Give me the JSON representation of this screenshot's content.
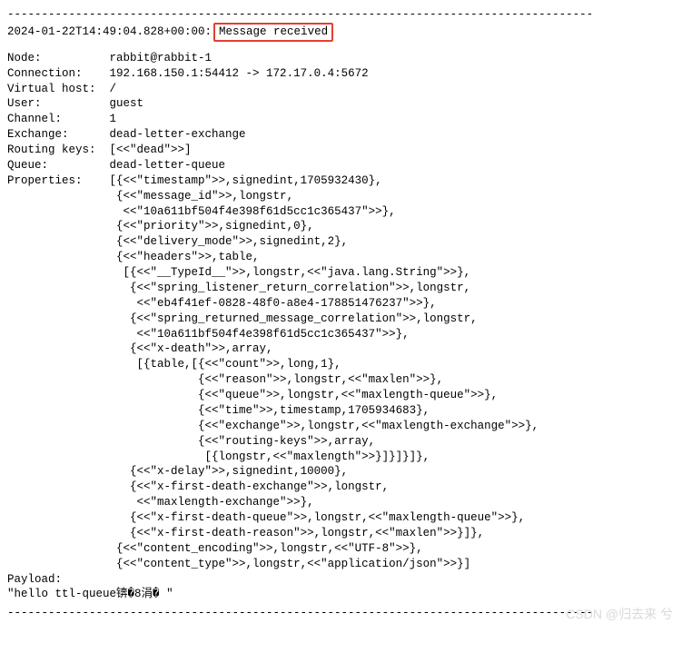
{
  "separator": "--------------------------------------------------------------------------------------",
  "header": {
    "timestamp": "2024-01-22T14:49:04.828+00:00:",
    "status": " Message received "
  },
  "fields": {
    "node": {
      "key": "Node:          ",
      "val": "rabbit@rabbit-1"
    },
    "connection": {
      "key": "Connection:    ",
      "val": "192.168.150.1:54412 -> 172.17.0.4:5672"
    },
    "vhost": {
      "key": "Virtual host:  ",
      "val": "/"
    },
    "user": {
      "key": "User:          ",
      "val": "guest"
    },
    "channel": {
      "key": "Channel:       ",
      "val": "1"
    },
    "exchange": {
      "key": "Exchange:      ",
      "val": "dead-letter-exchange"
    },
    "routing": {
      "key": "Routing keys:  ",
      "val": "[<<\"dead\">>]"
    },
    "queue": {
      "key": "Queue:         ",
      "val": "dead-letter-queue"
    }
  },
  "properties_label": "Properties:    ",
  "properties_lines": "[{<<\"timestamp\">>,signedint,1705932430},\n {<<\"message_id\">>,longstr,\n  <<\"10a611bf504f4e398f61d5cc1c365437\">>},\n {<<\"priority\">>,signedint,0},\n {<<\"delivery_mode\">>,signedint,2},\n {<<\"headers\">>,table,\n  [{<<\"__TypeId__\">>,longstr,<<\"java.lang.String\">>},\n   {<<\"spring_listener_return_correlation\">>,longstr,\n    <<\"eb4f41ef-0828-48f0-a8e4-178851476237\">>},\n   {<<\"spring_returned_message_correlation\">>,longstr,\n    <<\"10a611bf504f4e398f61d5cc1c365437\">>},\n   {<<\"x-death\">>,array,\n    [{table,[{<<\"count\">>,long,1},\n             {<<\"reason\">>,longstr,<<\"maxlen\">>},\n             {<<\"queue\">>,longstr,<<\"maxlength-queue\">>},\n             {<<\"time\">>,timestamp,1705934683},\n             {<<\"exchange\">>,longstr,<<\"maxlength-exchange\">>},\n             {<<\"routing-keys\">>,array,\n              [{longstr,<<\"maxlength\">>}]}]}]},\n   {<<\"x-delay\">>,signedint,10000},\n   {<<\"x-first-death-exchange\">>,longstr,\n    <<\"maxlength-exchange\">>},\n   {<<\"x-first-death-queue\">>,longstr,<<\"maxlength-queue\">>},\n   {<<\"x-first-death-reason\">>,longstr,<<\"maxlen\">>}]},\n {<<\"content_encoding\">>,longstr,<<\"UTF-8\">>},\n {<<\"content_type\">>,longstr,<<\"application/json\">>}]",
  "payload": {
    "label": "Payload:",
    "value": "\"hello ttl-queue锛�8涓� \""
  },
  "watermark": "CSDN @归去来 兮"
}
